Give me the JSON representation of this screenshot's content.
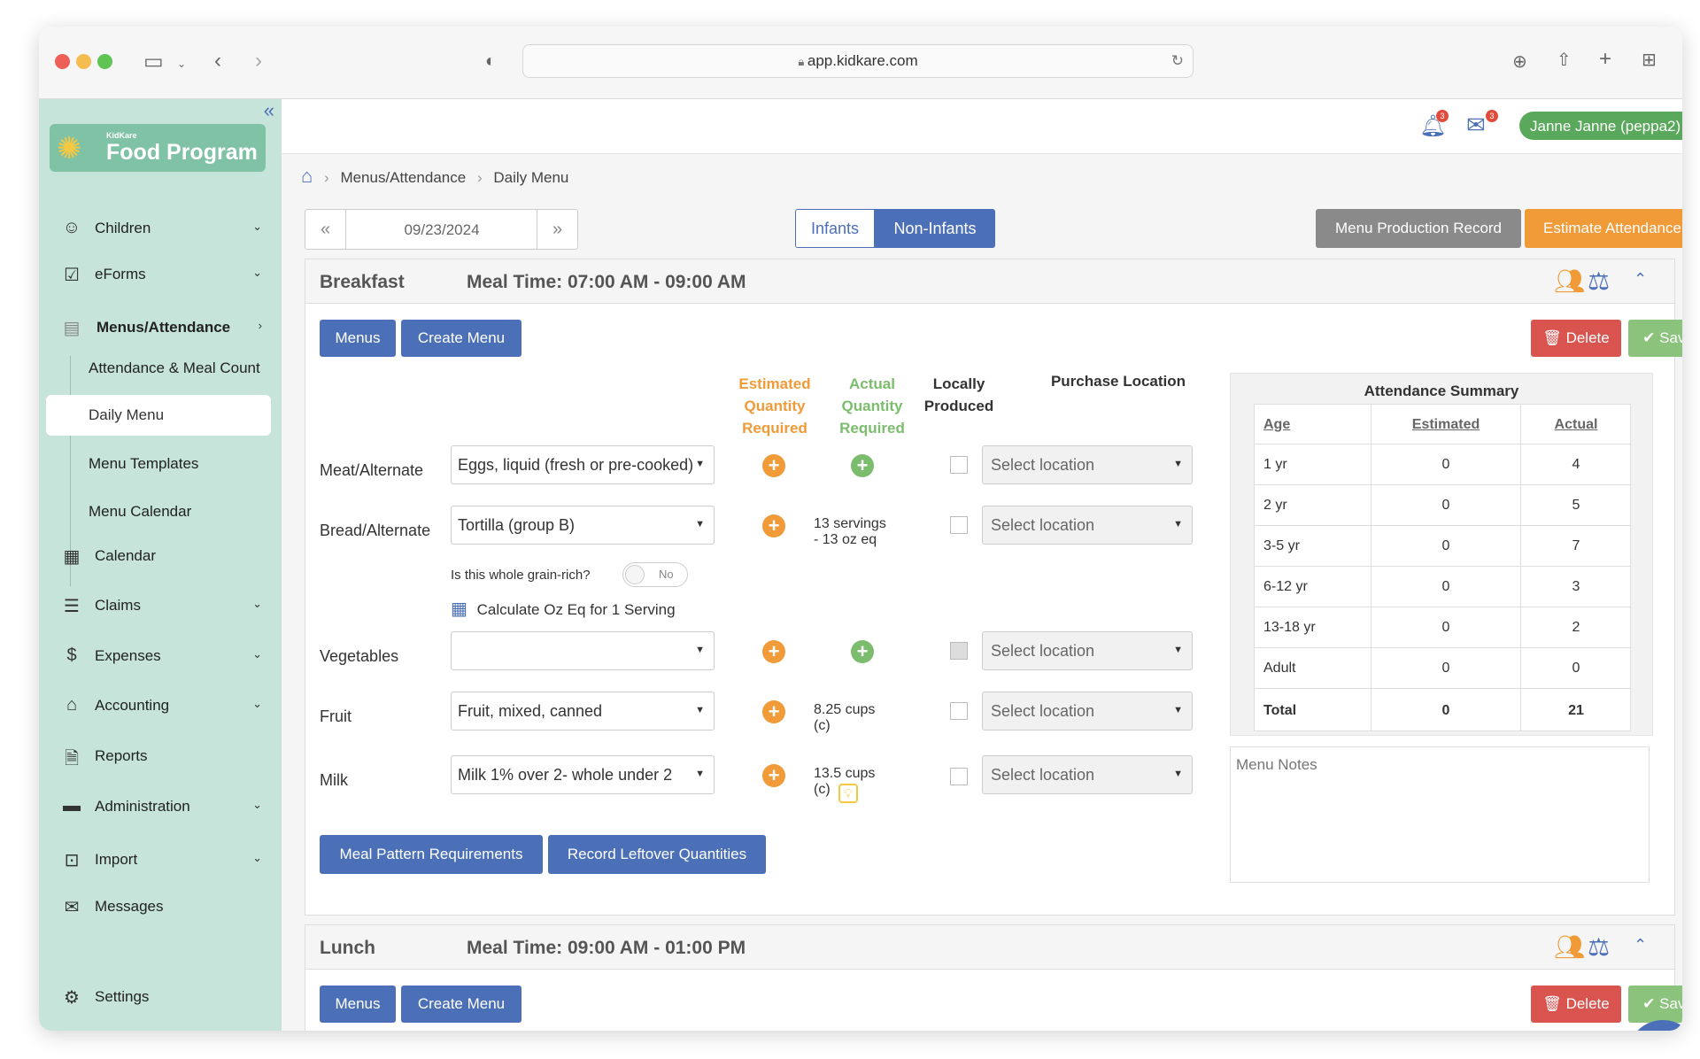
{
  "browser": {
    "url": "app.kidkare.com"
  },
  "colors": {
    "sidebar": "#c6e4da",
    "primary": "#4c70b8",
    "orange": "#f09a38",
    "green": "#7cbd6d",
    "gray_btn": "#8a8a8a",
    "delete": "#d9534f",
    "save": "#8bc37c"
  },
  "sidebar": {
    "logo": {
      "small": "KidKare",
      "big": "Food Program"
    },
    "items": [
      {
        "label": "Children",
        "icon": "child-face-icon"
      },
      {
        "label": "eForms",
        "icon": "checkbox-icon"
      },
      {
        "label": "Menus/Attendance",
        "icon": "clipboard-icon"
      },
      {
        "label": "Calendar",
        "icon": "calendar-icon"
      },
      {
        "label": "Claims",
        "icon": "claims-stack-icon"
      },
      {
        "label": "Expenses",
        "icon": "dollar-icon"
      },
      {
        "label": "Accounting",
        "icon": "bank-icon"
      },
      {
        "label": "Reports",
        "icon": "report-icon"
      },
      {
        "label": "Administration",
        "icon": "briefcase-icon"
      },
      {
        "label": "Import",
        "icon": "import-icon"
      },
      {
        "label": "Messages",
        "icon": "envelope-icon"
      },
      {
        "label": "Settings",
        "icon": "gear-icon"
      }
    ],
    "sub_items": [
      "Attendance & Meal Count",
      "Daily Menu",
      "Menu Templates",
      "Menu Calendar"
    ]
  },
  "topbar": {
    "notifications_count": "3",
    "messages_count": "3",
    "user": "Janne Janne (peppa2)"
  },
  "breadcrumb": {
    "parent": "Menus/Attendance",
    "current": "Daily Menu"
  },
  "toolbar": {
    "date": "09/23/2024",
    "tabs": [
      "Infants",
      "Non-Infants"
    ],
    "active_tab": "Non-Infants",
    "menu_production": "Menu Production Record",
    "estimate_attendance": "Estimate Attendance"
  },
  "breakfast": {
    "title": "Breakfast",
    "meal_time": "Meal Time: 07:00 AM - 09:00 AM",
    "menus_btn": "Menus",
    "create_menu_btn": "Create Menu",
    "delete_btn": "Delete",
    "save_btn": "Save",
    "headers": {
      "estimated": [
        "Estimated",
        "Quantity",
        "Required"
      ],
      "actual": [
        "Actual",
        "Quantity",
        "Required"
      ],
      "local": [
        "Locally",
        "Produced"
      ],
      "purchase": "Purchase Location"
    },
    "rows": [
      {
        "component": "Meat/Alternate",
        "food": "Eggs, liquid (fresh or pre-cooked)",
        "actual": "",
        "location": "Select location"
      },
      {
        "component": "Bread/Alternate",
        "food": "Tortilla (group B)",
        "actual": "13 servings\n- 13 oz eq",
        "location": "Select location"
      },
      {
        "component": "Vegetables",
        "food": "",
        "actual": "",
        "location": "Select location"
      },
      {
        "component": "Fruit",
        "food": "Fruit, mixed, canned",
        "actual": "8.25 cups\n(c)",
        "location": "Select location"
      },
      {
        "component": "Milk",
        "food": "Milk 1% over 2- whole under 2",
        "actual": "13.5 cups\n(c)",
        "location": "Select location"
      }
    ],
    "grain_question": "Is this whole grain-rich?",
    "grain_toggle": "No",
    "calc_oz": "Calculate Oz Eq for 1 Serving",
    "meal_pattern_btn": "Meal Pattern Requirements",
    "leftover_btn": "Record Leftover Quantities",
    "attendance": {
      "title": "Attendance Summary",
      "headers": [
        "Age",
        "Estimated",
        "Actual"
      ],
      "rows": [
        [
          "1 yr",
          "0",
          "4"
        ],
        [
          "2 yr",
          "0",
          "5"
        ],
        [
          "3-5 yr",
          "0",
          "7"
        ],
        [
          "6-12 yr",
          "0",
          "3"
        ],
        [
          "13-18 yr",
          "0",
          "2"
        ],
        [
          "Adult",
          "0",
          "0"
        ]
      ],
      "total": [
        "Total",
        "0",
        "21"
      ]
    },
    "notes_placeholder": "Menu Notes"
  },
  "lunch": {
    "title": "Lunch",
    "meal_time": "Meal Time: 09:00 AM - 01:00 PM",
    "menus_btn": "Menus",
    "create_menu_btn": "Create Menu",
    "delete_btn": "Delete",
    "save_btn": "Save"
  }
}
